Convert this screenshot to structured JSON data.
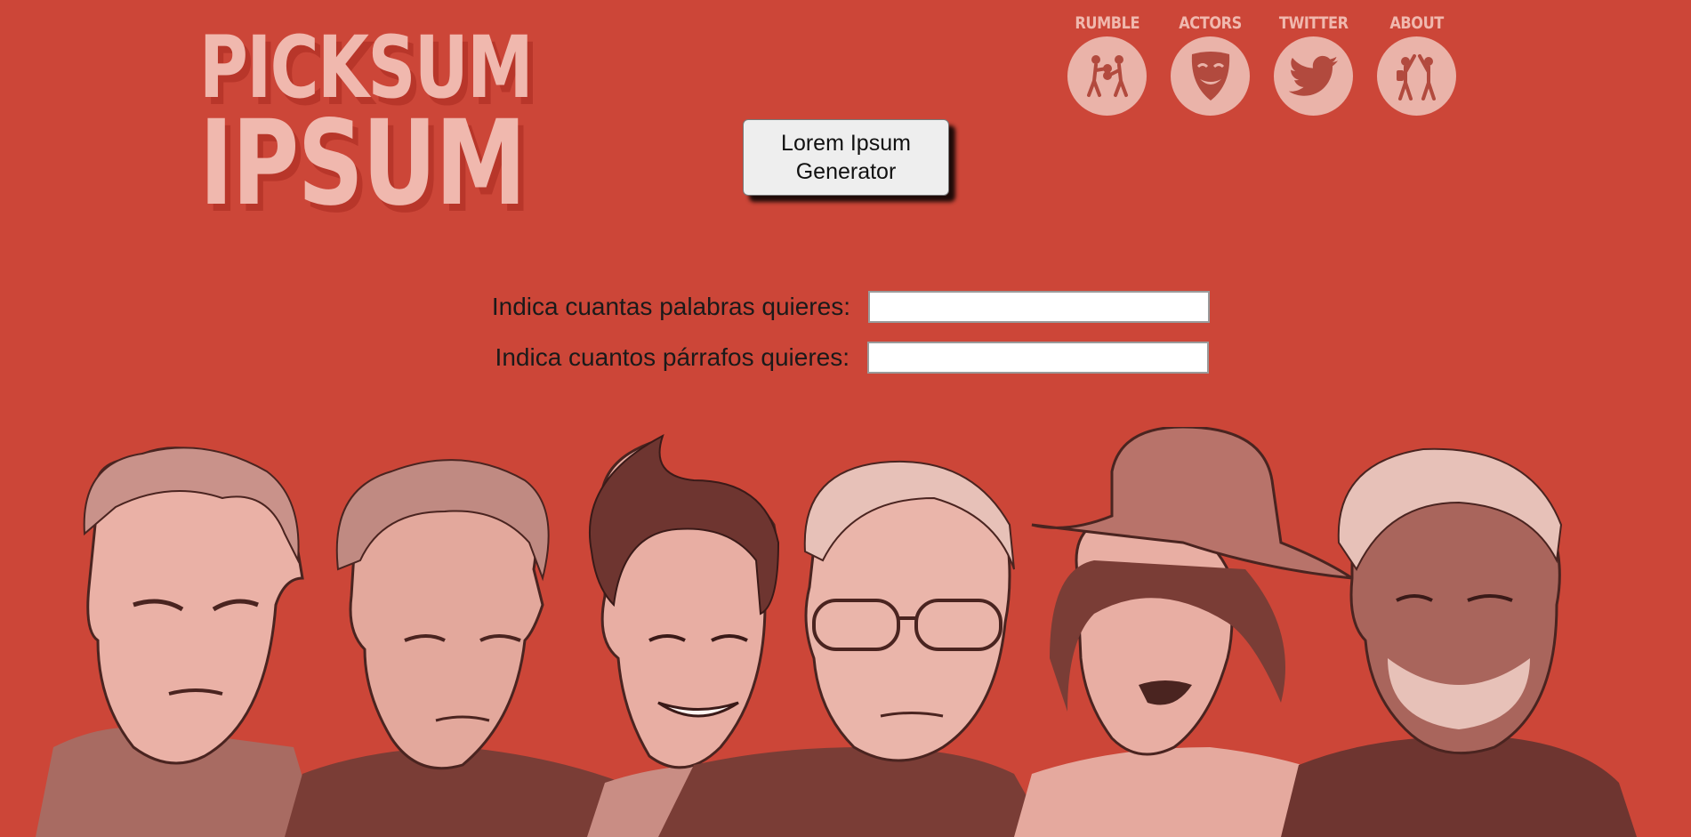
{
  "logo": {
    "line1": "PICKSUM",
    "line2": "IPSUM"
  },
  "nav": [
    {
      "label": "RUMBLE",
      "icon": "boxers-icon"
    },
    {
      "label": "ACTORS",
      "icon": "theater-mask-icon"
    },
    {
      "label": "TWITTER",
      "icon": "twitter-bird-icon"
    },
    {
      "label": "ABOUT",
      "icon": "high-five-icon"
    }
  ],
  "generator_button": {
    "label": "Lorem Ipsum Generator"
  },
  "form": {
    "words_label": "Indica cuantas palabras quieres:",
    "words_value": "",
    "paragraphs_label": "Indica cuantos párrafos quieres:",
    "paragraphs_value": ""
  },
  "colors": {
    "background": "#cc4638",
    "accent_pink": "#f0b8ae",
    "dark_brown": "#6e3530"
  }
}
